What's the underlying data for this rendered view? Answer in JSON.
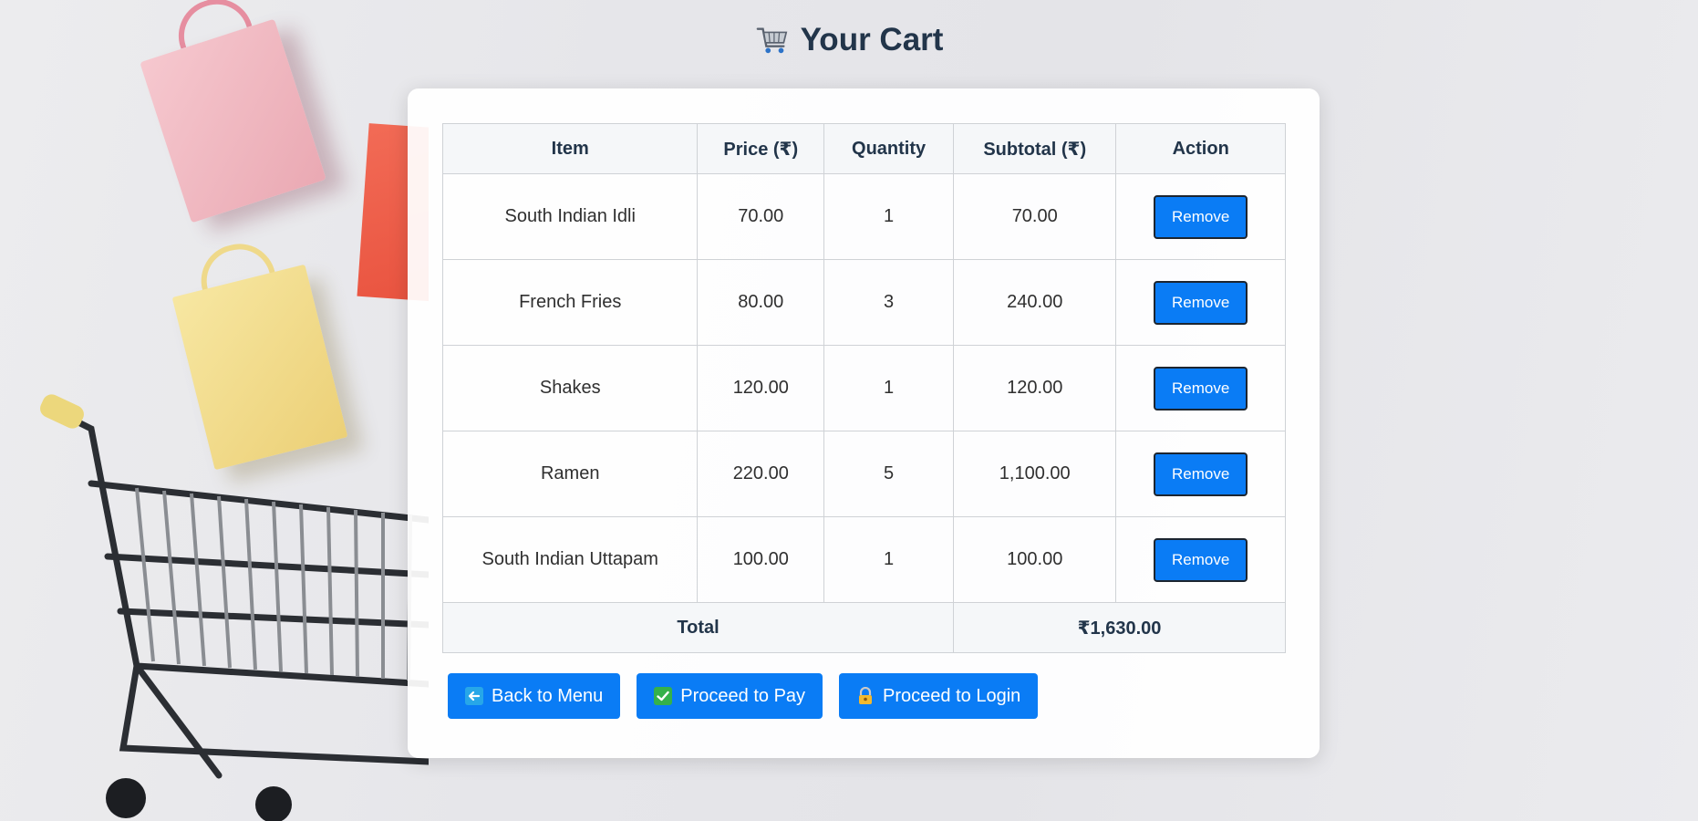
{
  "header": {
    "title": "Your Cart",
    "icon": "shopping-cart-icon"
  },
  "table": {
    "columns": [
      "Item",
      "Price (₹)",
      "Quantity",
      "Subtotal (₹)",
      "Action"
    ],
    "rows": [
      {
        "item": "South Indian Idli",
        "price": "70.00",
        "quantity": "1",
        "subtotal": "70.00",
        "action": "Remove"
      },
      {
        "item": "French Fries",
        "price": "80.00",
        "quantity": "3",
        "subtotal": "240.00",
        "action": "Remove"
      },
      {
        "item": "Shakes",
        "price": "120.00",
        "quantity": "1",
        "subtotal": "120.00",
        "action": "Remove"
      },
      {
        "item": "Ramen",
        "price": "220.00",
        "quantity": "5",
        "subtotal": "1,100.00",
        "action": "Remove"
      },
      {
        "item": "South Indian Uttapam",
        "price": "100.00",
        "quantity": "1",
        "subtotal": "100.00",
        "action": "Remove"
      }
    ],
    "total_label": "Total",
    "total_value": "₹1,630.00"
  },
  "actions": {
    "back": {
      "label": "Back to Menu",
      "icon": "back-arrow-icon"
    },
    "pay": {
      "label": "Proceed to Pay",
      "icon": "check-mark-icon"
    },
    "login": {
      "label": "Proceed to Login",
      "icon": "lock-key-icon"
    }
  },
  "colors": {
    "primary_button": "#0a7cf5",
    "title_text": "#22354a",
    "card_background": "#ffffff"
  }
}
